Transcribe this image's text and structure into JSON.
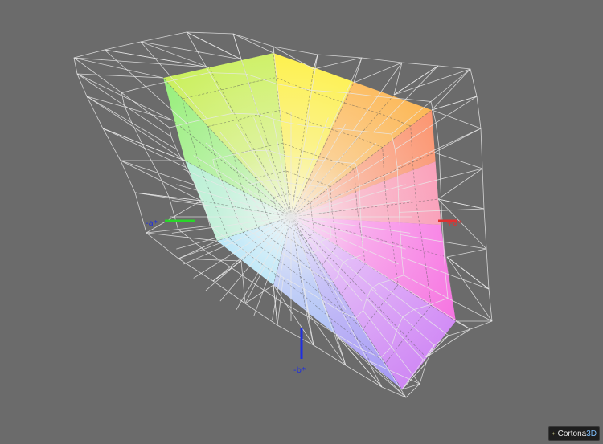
{
  "axes": {
    "a_neg": "-a*",
    "a_pos": "+a*",
    "b_neg": "-b*"
  },
  "logo": {
    "brand_name": "Cortona",
    "brand_suffix": "3D",
    "icon": "cortona-star-icon"
  },
  "colors": {
    "background": "#6b6b6b",
    "wireframe": "#e8e8e8",
    "axis_green": "#29d629",
    "axis_red": "#e03030",
    "axis_blue": "#1f2fe0"
  }
}
